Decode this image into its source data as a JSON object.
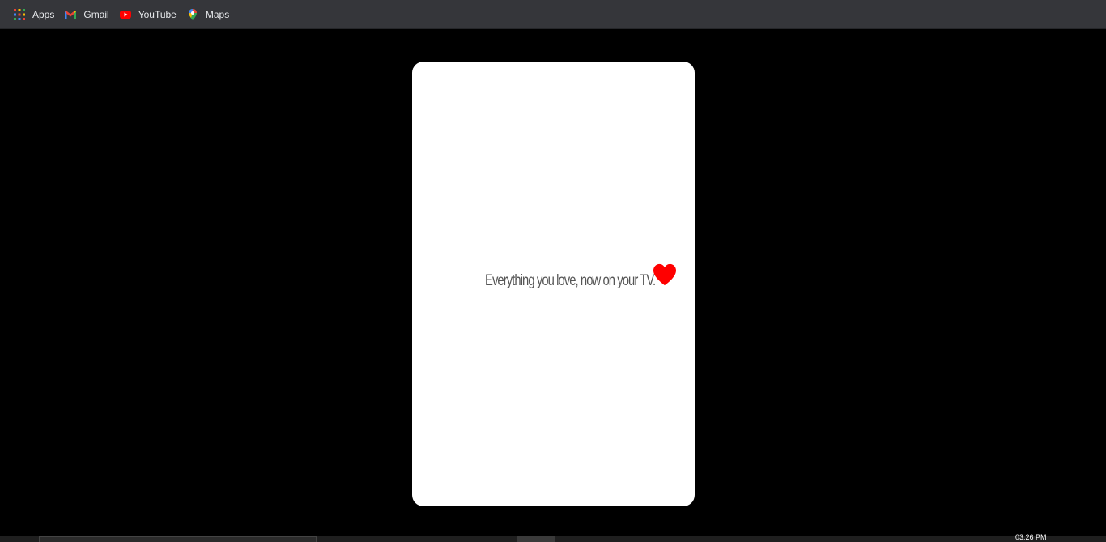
{
  "bookmarks": [
    {
      "label": "Apps",
      "icon": "apps-grid-icon"
    },
    {
      "label": "Gmail",
      "icon": "gmail-icon"
    },
    {
      "label": "YouTube",
      "icon": "youtube-icon"
    },
    {
      "label": "Maps",
      "icon": "maps-pin-icon"
    }
  ],
  "card": {
    "tagline": "Everything you love, now on your TV.",
    "heart_color": "#ff0000"
  },
  "taskbar": {
    "clock": "03:26 PM"
  },
  "colors": {
    "bookmarks_bar_bg": "#35363a",
    "page_bg": "#000000",
    "card_bg": "#ffffff",
    "bookmark_text": "#e8eaed"
  }
}
